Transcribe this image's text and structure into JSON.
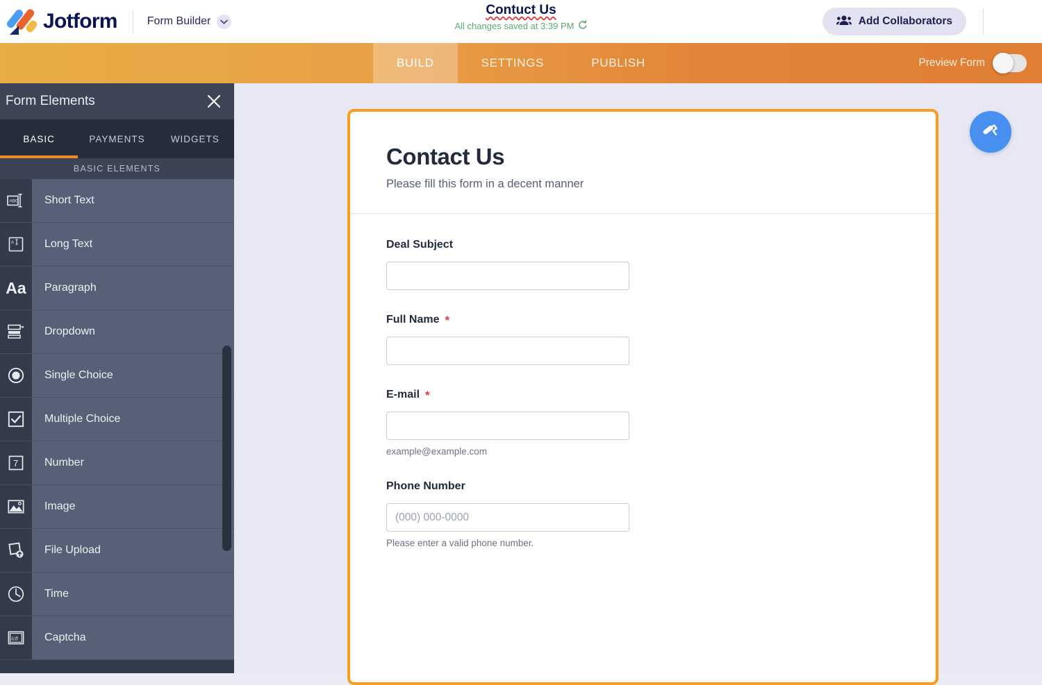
{
  "header": {
    "brand": "Jotform",
    "brand_logo_name": "jotform-logo",
    "product": "Form Builder",
    "product_chevron": "chevron-down-icon",
    "form_title": "Contuct Us",
    "save_status": "All changes saved at 3:39 PM",
    "save_icon": "undo-icon",
    "collaborators_label": "Add Collaborators",
    "collaborators_icon": "people-icon"
  },
  "navbar": {
    "tabs": [
      {
        "label": "BUILD",
        "active": true
      },
      {
        "label": "SETTINGS",
        "active": false
      },
      {
        "label": "PUBLISH",
        "active": false
      }
    ],
    "preview_label": "Preview Form",
    "preview_toggle_state": "off",
    "accent_left": "#e9ad45",
    "accent_right": "#e07f34"
  },
  "sidebar": {
    "title": "Form Elements",
    "close_icon": "close-icon",
    "tabs": [
      {
        "label": "BASIC",
        "active": true
      },
      {
        "label": "PAYMENTS",
        "active": false
      },
      {
        "label": "WIDGETS",
        "active": false
      }
    ],
    "active_tab_indicator_color": "#ed8b29",
    "section_title": "BASIC ELEMENTS",
    "items": [
      {
        "label": "Short Text",
        "icon": "short-text-icon"
      },
      {
        "label": "Long Text",
        "icon": "long-text-icon"
      },
      {
        "label": "Paragraph",
        "icon": "paragraph-icon"
      },
      {
        "label": "Dropdown",
        "icon": "dropdown-icon"
      },
      {
        "label": "Single Choice",
        "icon": "radio-button-icon"
      },
      {
        "label": "Multiple Choice",
        "icon": "checkbox-icon"
      },
      {
        "label": "Number",
        "icon": "number-icon"
      },
      {
        "label": "Image",
        "icon": "image-icon"
      },
      {
        "label": "File Upload",
        "icon": "file-upload-icon"
      },
      {
        "label": "Time",
        "icon": "clock-icon"
      },
      {
        "label": "Captcha",
        "icon": "captcha-icon"
      }
    ]
  },
  "form": {
    "title": "Contact Us",
    "subtitle": "Please fill this form in a decent manner",
    "border_color": "#f89c1c",
    "fields": [
      {
        "label": "Deal Subject",
        "required": false,
        "required_mark": "",
        "value": "",
        "placeholder": "",
        "hint": ""
      },
      {
        "label": "Full Name",
        "required": true,
        "required_mark": "*",
        "value": "",
        "placeholder": "",
        "hint": ""
      },
      {
        "label": "E-mail",
        "required": true,
        "required_mark": "*",
        "value": "",
        "placeholder": "",
        "hint": "example@example.com"
      },
      {
        "label": "Phone Number",
        "required": false,
        "required_mark": "",
        "value": "",
        "placeholder": "(000) 000-0000",
        "hint": "Please enter a valid phone number."
      }
    ]
  },
  "designer": {
    "icon": "paint-roller-icon",
    "color": "#4790f0"
  }
}
